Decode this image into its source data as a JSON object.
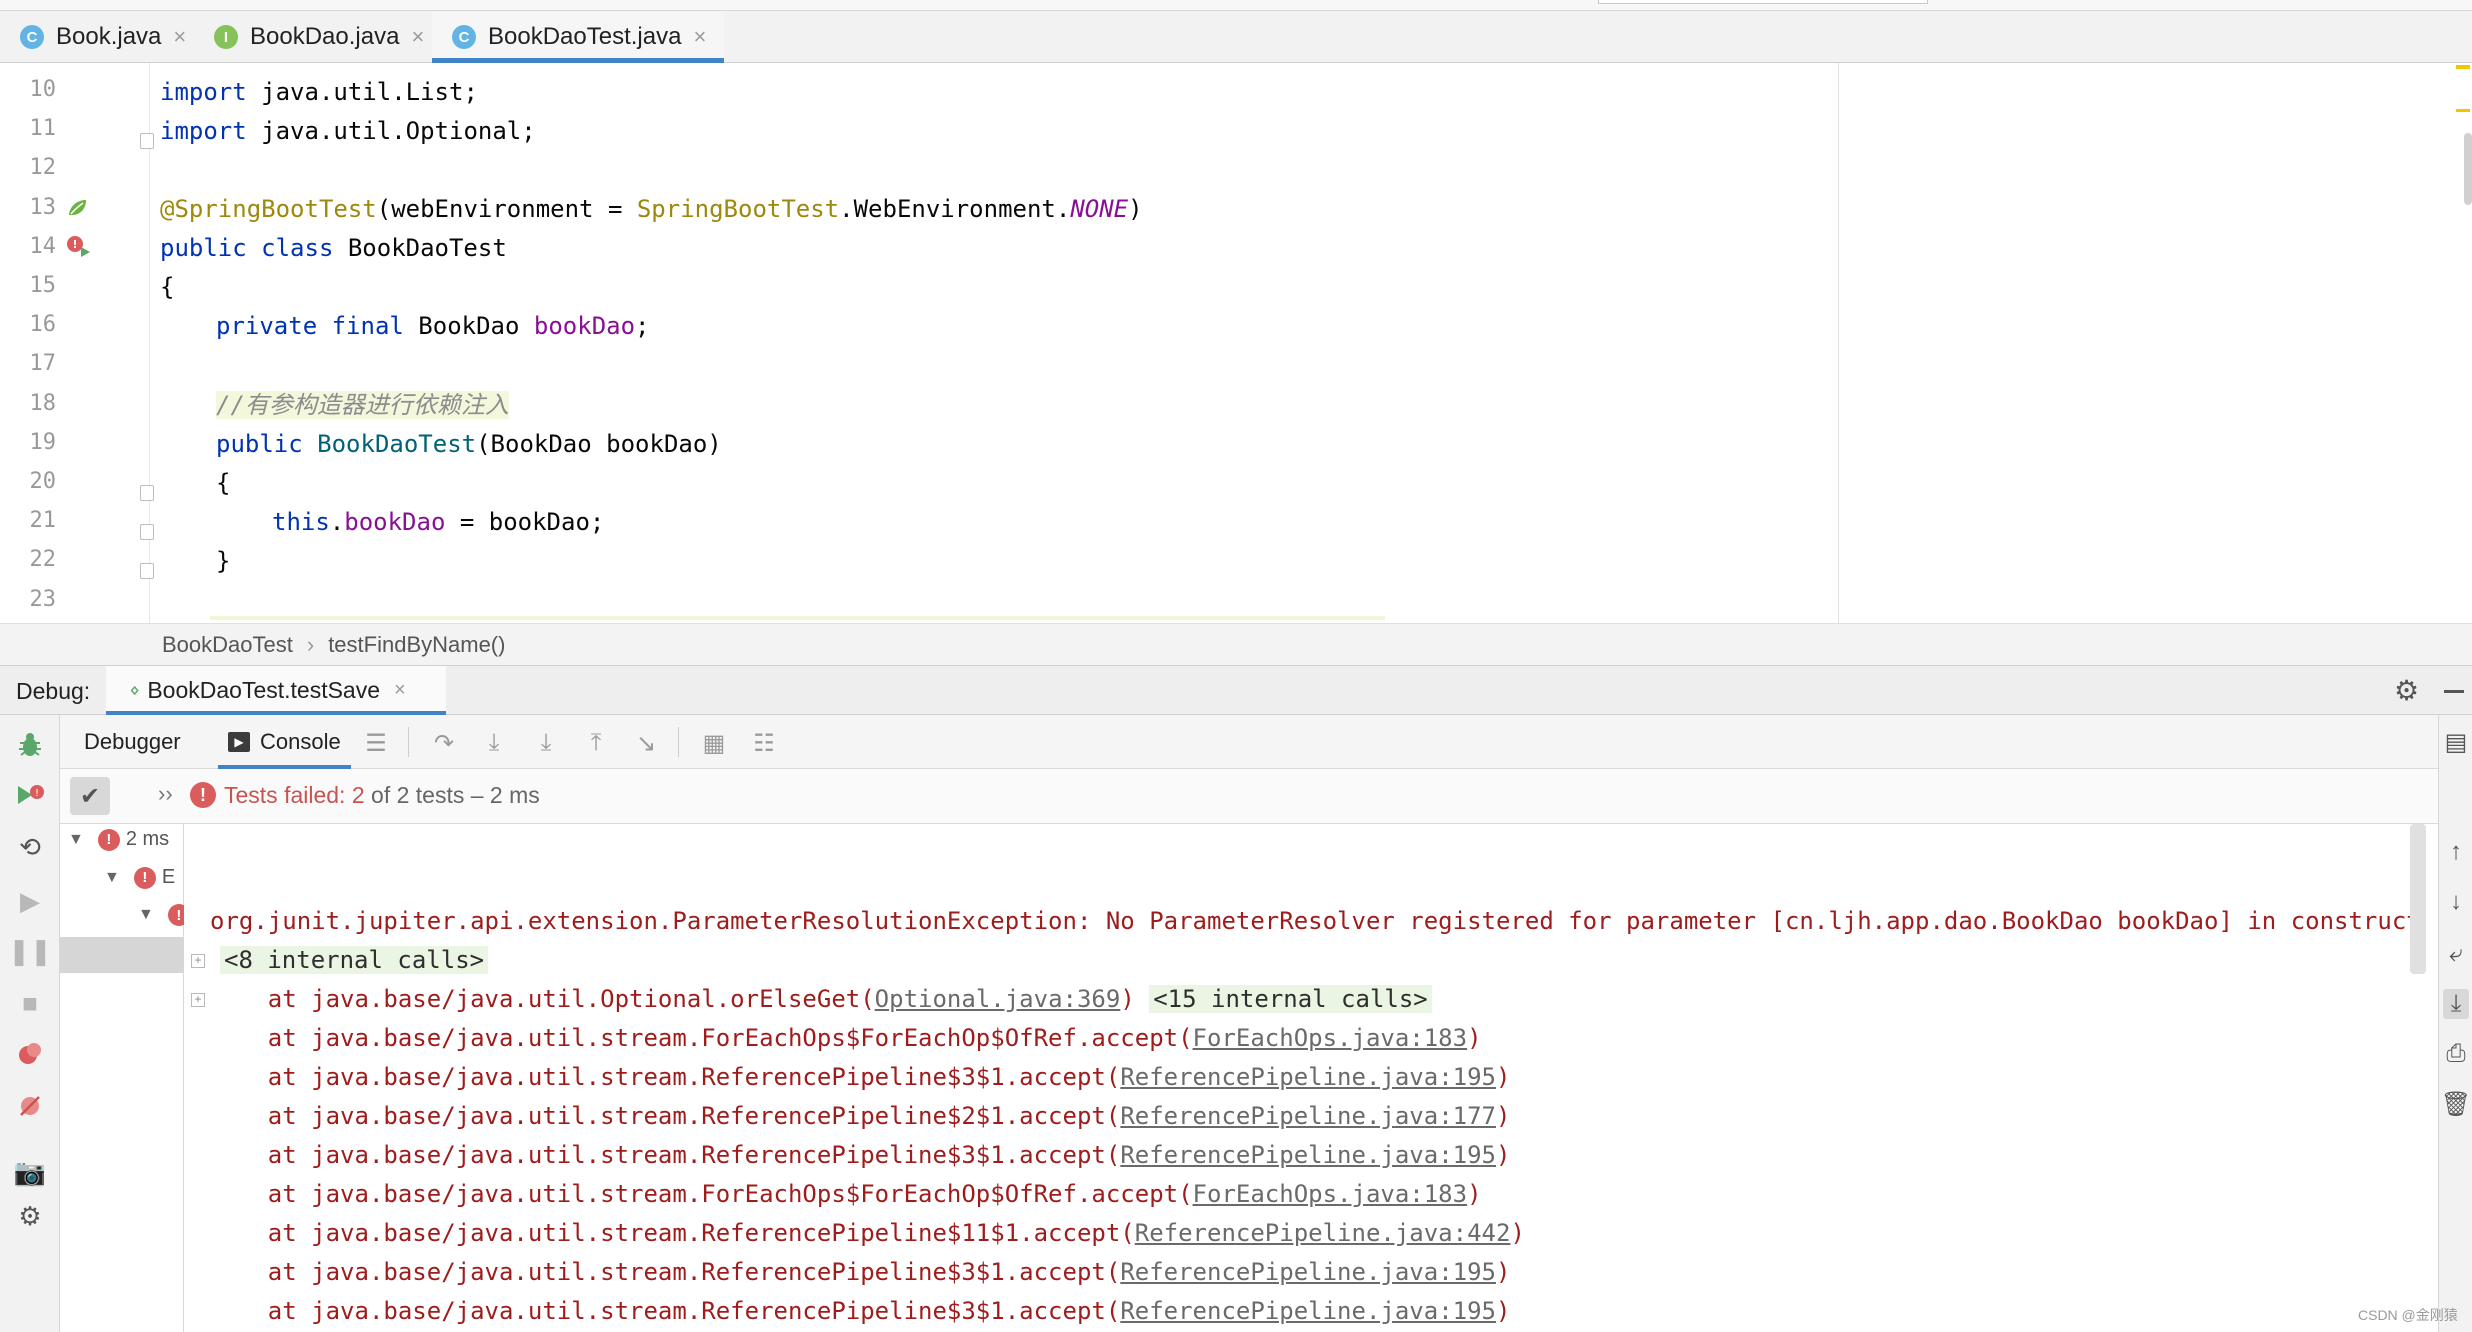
{
  "editor_tabs": [
    {
      "label": "Book.java",
      "icon": "C"
    },
    {
      "label": "BookDao.java",
      "icon": "I"
    },
    {
      "label": "BookDaoTest.java",
      "icon": "C"
    }
  ],
  "code": {
    "line_numbers": [
      "10",
      "11",
      "12",
      "13",
      "14",
      "15",
      "16",
      "17",
      "18",
      "19",
      "20",
      "21",
      "22",
      "23"
    ],
    "l10": {
      "kw": "import",
      "rest": " java.util.List;"
    },
    "l11": {
      "kw": "import",
      "rest": " java.util.Optional;"
    },
    "l13": {
      "ann": "@SpringBootTest",
      "a": "(webEnvironment = ",
      "ann2": "SpringBootTest",
      "b": ".WebEnvironment.",
      "cst": "NONE",
      "c": ")"
    },
    "l14": {
      "kw": "public class",
      "rest": " BookDaoTest"
    },
    "l15": "{",
    "l16": {
      "kw": "private final",
      "rest": " BookDao ",
      "fld": "bookDao",
      "end": ";"
    },
    "l18": "//有参构造器进行依赖注入",
    "l19": {
      "kw": "public",
      "sp": " ",
      "fn": "BookDaoTest",
      "rest": "(BookDao bookDao)"
    },
    "l20": "{",
    "l21": {
      "kw": "this",
      "dot": ".",
      "fld": "bookDao",
      "rest": " = bookDao;"
    },
    "l22": "}"
  },
  "breadcrumb": {
    "class_name": "BookDaoTest",
    "sep": "›",
    "method": "testFindByName()"
  },
  "debug": {
    "label": "Debug:",
    "session_tab": "BookDaoTest.testSave",
    "subtabs": {
      "debugger": "Debugger",
      "console": "Console"
    }
  },
  "status": {
    "chev": "››",
    "failed": "Tests failed: 2",
    "rest": " of 2 tests – 2 ms"
  },
  "tree": {
    "root_time": "2 ms",
    "child_label": "E"
  },
  "console": {
    "exception": "org.junit.jupiter.api.extension.ParameterResolutionException: No ParameterResolver registered for parameter [cn.ljh.app.dao.BookDao bookDao] in constructor [pu",
    "internal_calls_8": "<8 internal calls>",
    "frames": [
      {
        "prefix": "    at java.base/java.util.Optional.orElseGet(",
        "link": "Optional.java:369",
        "suffix": ") ",
        "internal": "<15 internal calls>"
      },
      {
        "prefix": "    at java.base/java.util.stream.ForEachOps$ForEachOp$OfRef.accept(",
        "link": "ForEachOps.java:183",
        "suffix": ")",
        "internal": ""
      },
      {
        "prefix": "    at java.base/java.util.stream.ReferencePipeline$3$1.accept(",
        "link": "ReferencePipeline.java:195",
        "suffix": ")",
        "internal": ""
      },
      {
        "prefix": "    at java.base/java.util.stream.ReferencePipeline$2$1.accept(",
        "link": "ReferencePipeline.java:177",
        "suffix": ")",
        "internal": ""
      },
      {
        "prefix": "    at java.base/java.util.stream.ReferencePipeline$3$1.accept(",
        "link": "ReferencePipeline.java:195",
        "suffix": ")",
        "internal": ""
      },
      {
        "prefix": "    at java.base/java.util.stream.ForEachOps$ForEachOp$OfRef.accept(",
        "link": "ForEachOps.java:183",
        "suffix": ")",
        "internal": ""
      },
      {
        "prefix": "    at java.base/java.util.stream.ReferencePipeline$11$1.accept(",
        "link": "ReferencePipeline.java:442",
        "suffix": ")",
        "internal": ""
      },
      {
        "prefix": "    at java.base/java.util.stream.ReferencePipeline$3$1.accept(",
        "link": "ReferencePipeline.java:195",
        "suffix": ")",
        "internal": ""
      },
      {
        "prefix": "    at java.base/java.util.stream.ReferencePipeline$3$1.accept(",
        "link": "ReferencePipeline.java:195",
        "suffix": ")",
        "internal": ""
      }
    ]
  },
  "watermark": "CSDN @金刚猿",
  "colors": {
    "accent": "#4083c9",
    "error": "#db5c5c",
    "exception_text": "#9e1c1c"
  }
}
